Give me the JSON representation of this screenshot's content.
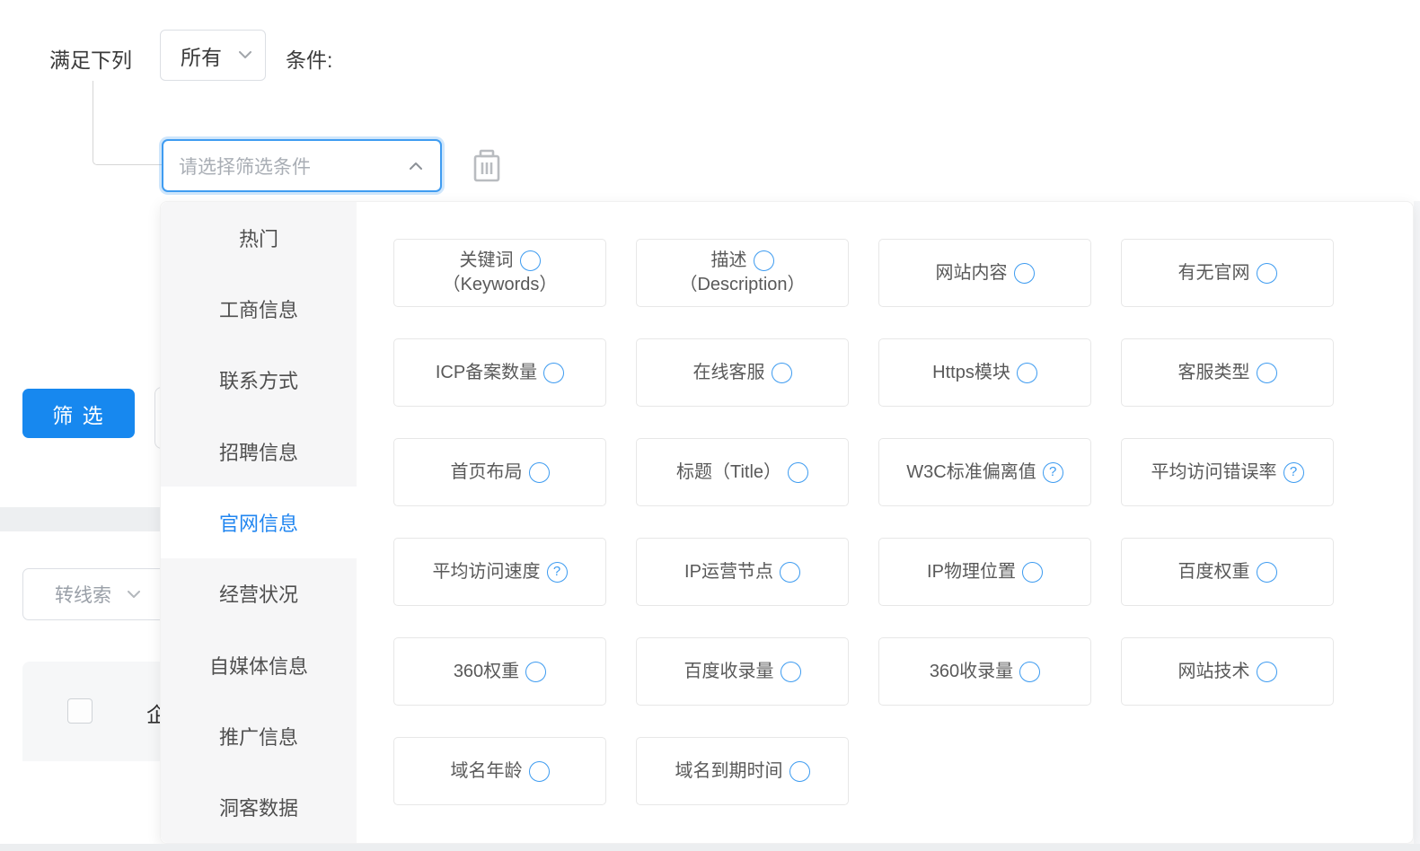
{
  "header": {
    "match_label": "满足下列",
    "match_value": "所有",
    "conditions_suffix": "条件:"
  },
  "filter_select": {
    "placeholder": "请选择筛选条件"
  },
  "toolbar": {
    "filter_button_label": "筛 选",
    "convert_select_value": "转线索"
  },
  "table": {
    "partial_header_text": "企"
  },
  "dropdown": {
    "categories": [
      {
        "label": "热门",
        "active": false
      },
      {
        "label": "工商信息",
        "active": false
      },
      {
        "label": "联系方式",
        "active": false
      },
      {
        "label": "招聘信息",
        "active": false
      },
      {
        "label": "官网信息",
        "active": true
      },
      {
        "label": "经营状况",
        "active": false
      },
      {
        "label": "自媒体信息",
        "active": false
      },
      {
        "label": "推广信息",
        "active": false
      },
      {
        "label": "洞客数据",
        "active": false
      }
    ],
    "options": [
      {
        "label": "关键词",
        "sub": "（Keywords）",
        "help": false
      },
      {
        "label": "描述",
        "sub": "（Description）",
        "help": false
      },
      {
        "label": "网站内容",
        "sub": "",
        "help": false
      },
      {
        "label": "有无官网",
        "sub": "",
        "help": false
      },
      {
        "label": "ICP备案数量",
        "sub": "",
        "help": false
      },
      {
        "label": "在线客服",
        "sub": "",
        "help": false
      },
      {
        "label": "Https模块",
        "sub": "",
        "help": false
      },
      {
        "label": "客服类型",
        "sub": "",
        "help": false
      },
      {
        "label": "首页布局",
        "sub": "",
        "help": false
      },
      {
        "label": "标题（Title）",
        "sub": "",
        "help": false
      },
      {
        "label": "W3C标准偏离值",
        "sub": "",
        "help": true
      },
      {
        "label": "平均访问错误率",
        "sub": "",
        "help": true
      },
      {
        "label": "平均访问速度",
        "sub": "",
        "help": true
      },
      {
        "label": "IP运营节点",
        "sub": "",
        "help": false
      },
      {
        "label": "IP物理位置",
        "sub": "",
        "help": false
      },
      {
        "label": "百度权重",
        "sub": "",
        "help": false
      },
      {
        "label": "360权重",
        "sub": "",
        "help": false
      },
      {
        "label": "百度收录量",
        "sub": "",
        "help": false
      },
      {
        "label": "360收录量",
        "sub": "",
        "help": false
      },
      {
        "label": "网站技术",
        "sub": "",
        "help": false
      },
      {
        "label": "域名年龄",
        "sub": "",
        "help": false
      },
      {
        "label": "域名到期时间",
        "sub": "",
        "help": false
      }
    ]
  },
  "icons": {
    "help_glyph": "?"
  },
  "colors": {
    "accent_blue": "#1788ef",
    "active_text_blue": "#2186f0",
    "focus_border_blue": "#3f9cf1",
    "help_blue": "#3d9bf0",
    "sidebar_gray": "#f6f6f7",
    "border_gray": "#e7e7e7"
  }
}
